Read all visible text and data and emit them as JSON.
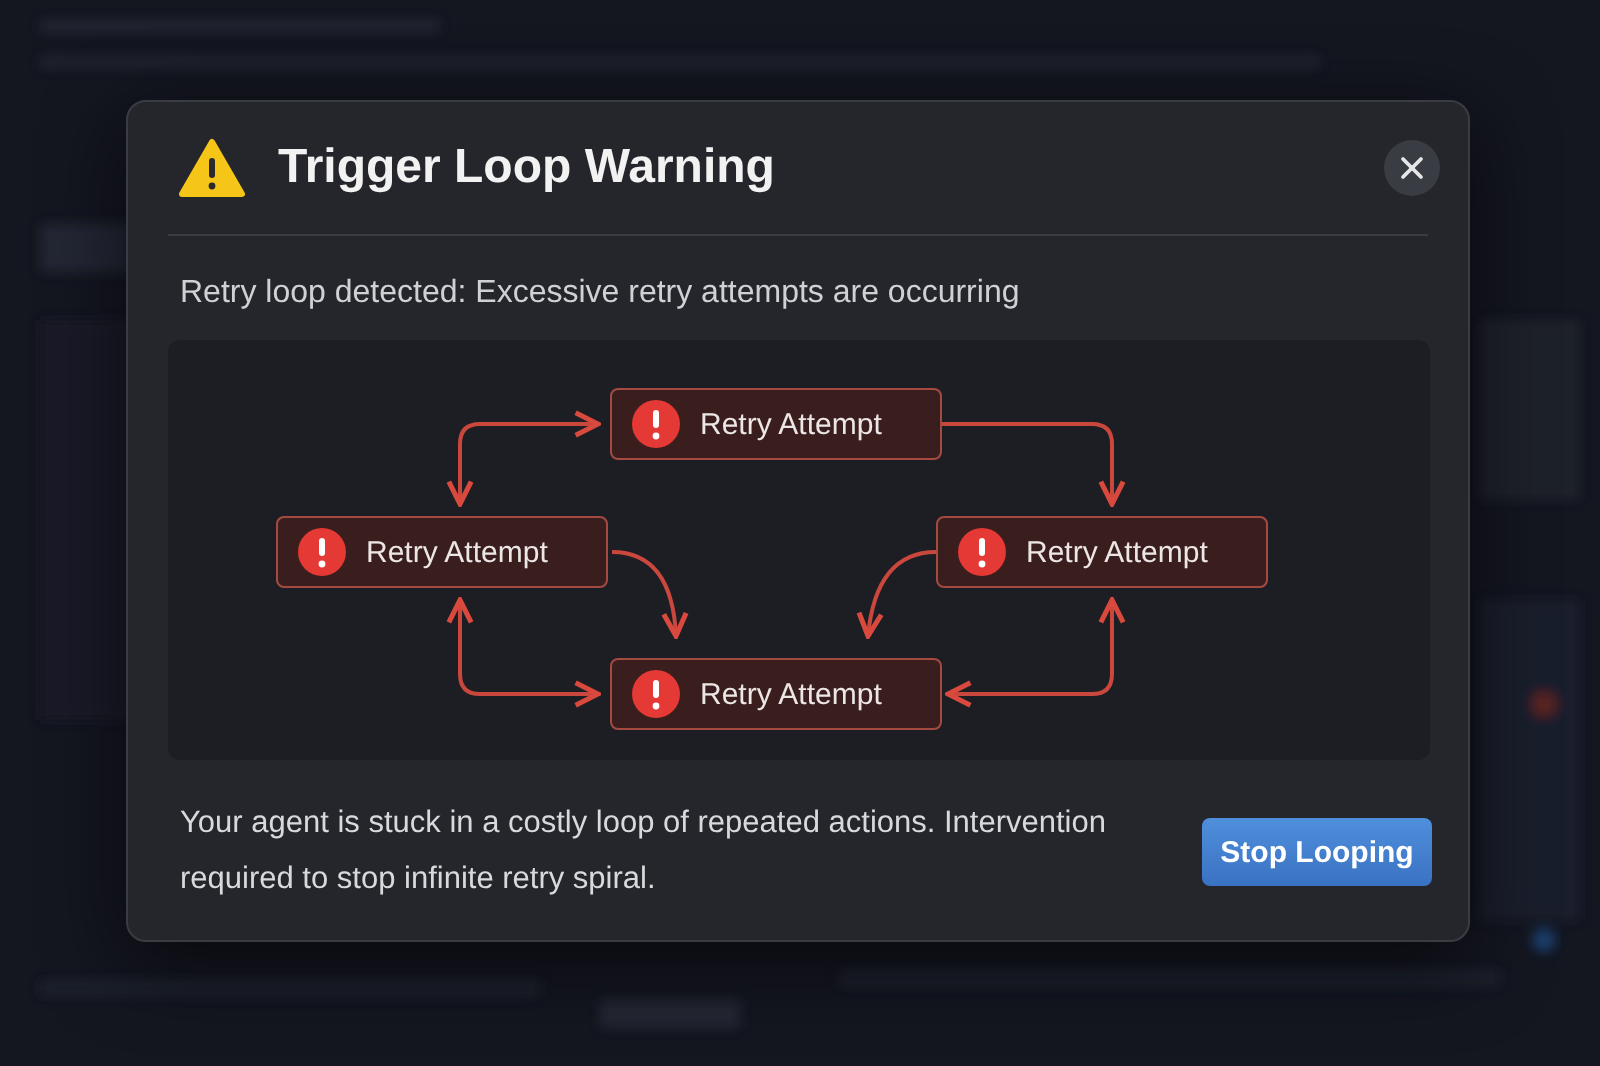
{
  "dialog": {
    "title": "Trigger Loop Warning",
    "subtitle": "Retry loop detected: Excessive retry attempts are occurring",
    "diagram": {
      "nodes": [
        {
          "label": "Retry Attempt"
        },
        {
          "label": "Retry Attempt"
        },
        {
          "label": "Retry Attempt"
        },
        {
          "label": "Retry Attempt"
        }
      ]
    },
    "message": "Your agent is stuck in a costly loop of repeated actions. Intervention required to stop infinite retry spiral.",
    "button": "Stop Looping"
  }
}
